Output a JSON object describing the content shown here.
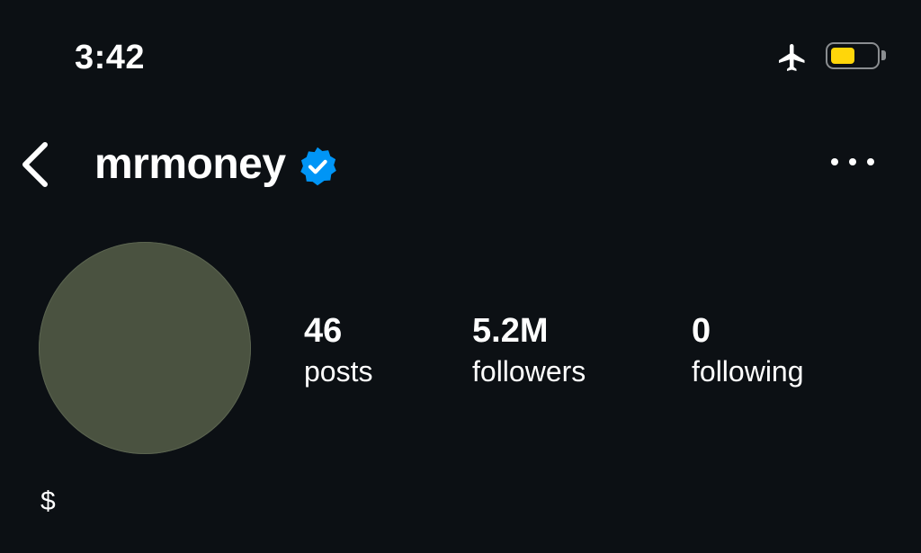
{
  "status_bar": {
    "time": "3:42",
    "icons": [
      "airplane-mode-icon",
      "battery-icon"
    ],
    "battery_level": 0.55,
    "battery_color": "#ffd60a"
  },
  "header": {
    "back_icon": "chevron-left-icon",
    "username": "mrmoney",
    "verified_icon": "verified-badge-icon",
    "verified_color": "#0095f6",
    "more_icon": "more-horizontal-icon"
  },
  "profile": {
    "avatar_color": "#4a5240",
    "stats": {
      "posts": {
        "value": "46",
        "label": "posts"
      },
      "followers": {
        "value": "5.2M",
        "label": "followers"
      },
      "following": {
        "value": "0",
        "label": "following"
      }
    },
    "bio": "$"
  },
  "colors": {
    "background": "#0c1014",
    "text": "#ffffff"
  }
}
